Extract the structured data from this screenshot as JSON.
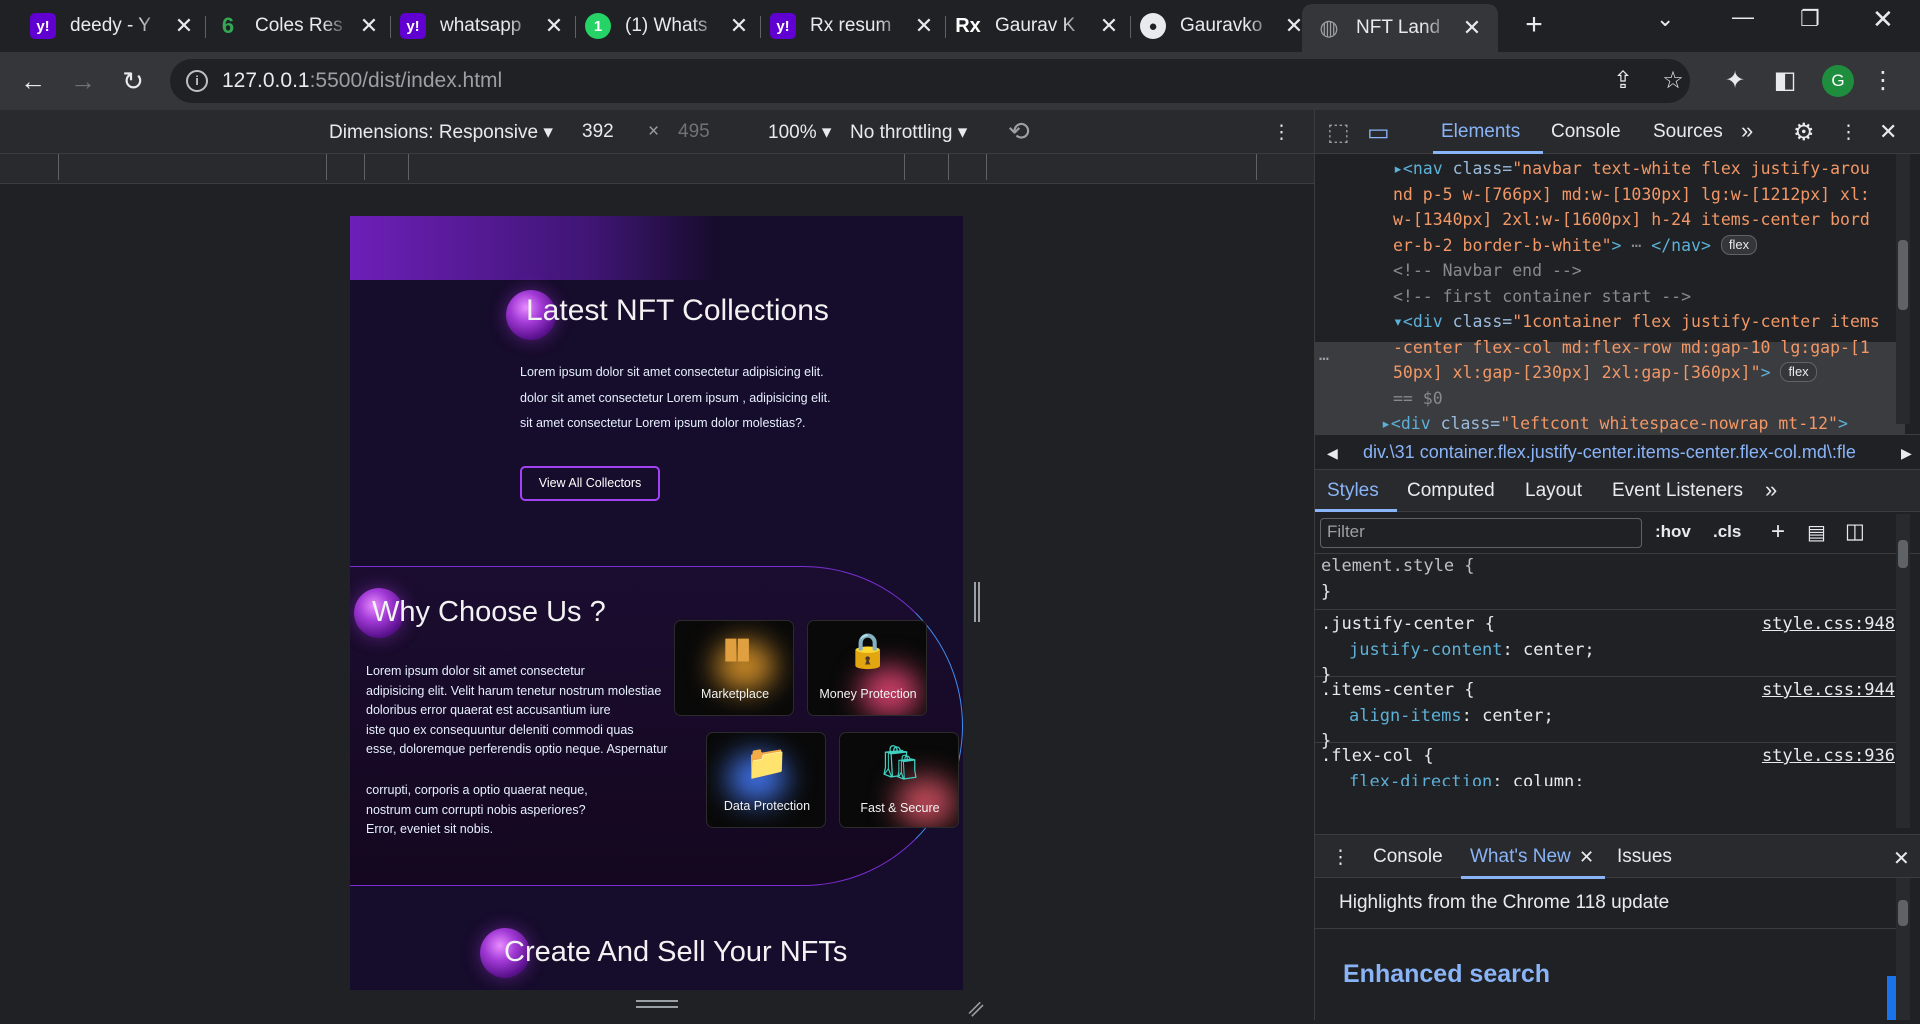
{
  "browser": {
    "tabs": [
      {
        "title": "deedy - Y",
        "favicon": "yahoo-icon",
        "favicon_text": "y!",
        "color": "#6001d2"
      },
      {
        "title": "Coles Res",
        "favicon": "coles-icon",
        "favicon_text": "6",
        "color": "#202124"
      },
      {
        "title": "whatsapp",
        "favicon": "yahoo-icon",
        "favicon_text": "y!",
        "color": "#6001d2"
      },
      {
        "title": "(1) Whats",
        "favicon": "whatsapp-icon",
        "favicon_text": "1",
        "color": "#25d366"
      },
      {
        "title": "Rx resum",
        "favicon": "yahoo-icon",
        "favicon_text": "y!",
        "color": "#6001d2"
      },
      {
        "title": "Gaurav K",
        "favicon": "rx-icon",
        "favicon_text": "Rx",
        "color": "#202124"
      },
      {
        "title": "Gauravko",
        "favicon": "github-icon",
        "favicon_text": "●",
        "color": "#202124"
      },
      {
        "title": "NFT Land",
        "favicon": "globe-icon",
        "favicon_text": "◍",
        "color": "#35363a"
      }
    ],
    "url_host": "127.0.0.1",
    "url_rest": ":5500/dist/index.html",
    "avatar_letter": "G"
  },
  "device_toolbar": {
    "dimensions_label": "Dimensions: Responsive",
    "width": "392",
    "times": "×",
    "height": "495",
    "zoom": "100%",
    "throttling": "No throttling"
  },
  "site": {
    "section1": {
      "title": "Latest NFT Collections",
      "lines": [
        "Lorem ipsum dolor sit amet consectetur adipisicing elit.",
        "dolor sit amet consectetur Lorem ipsum , adipisicing elit.",
        "sit amet consectetur Lorem ipsum dolor molestias?."
      ],
      "button": "View All Collectors"
    },
    "section2": {
      "title": "Why Choose Us ?",
      "lines_a": [
        "Lorem ipsum dolor sit amet consectetur",
        "adipisicing elit. Velit harum tenetur nostrum molestiae",
        "doloribus error quaerat est accusantium iure",
        "iste quo ex consequuntur deleniti commodi quas",
        "esse, doloremque perferendis optio neque. Aspernatur"
      ],
      "lines_b": [
        "corrupti, corporis a optio quaerat neque,",
        "nostrum cum corrupti nobis asperiores?",
        "Error, eveniet sit nobis."
      ],
      "cards": [
        {
          "label": "Marketplace",
          "icon": "marketplace-icon",
          "glyph": "▮▮",
          "glyph_color": "#e0a040",
          "glow": "#c98a28"
        },
        {
          "label": "Money Protection",
          "icon": "money-protection-icon",
          "glyph": "🔒",
          "glyph_color": "#20c0a0",
          "glow": "#d0406a"
        },
        {
          "label": "Data Protection",
          "icon": "data-protection-icon",
          "glyph": "📁",
          "glyph_color": "#3aa8ff",
          "glow": "#3f6fe0"
        },
        {
          "label": "Fast & Secure",
          "icon": "fast-secure-icon",
          "glyph": "🛍",
          "glyph_color": "#40d0c0",
          "glow": "#c04a5a"
        }
      ]
    },
    "section3": {
      "title": "Create And Sell Your NFTs"
    }
  },
  "devtools": {
    "tabs": [
      "Elements",
      "Console",
      "Sources"
    ],
    "dom_lines": [
      {
        "type": "code",
        "parts": [
          [
            "tag",
            "▸<nav "
          ],
          [
            "attr",
            "class="
          ],
          [
            "val",
            "\"navbar text-white flex justify-arou"
          ]
        ]
      },
      {
        "type": "code",
        "parts": [
          [
            "val",
            "nd p-5 w-[766px] md:w-[1030px] lg:w-[1212px] xl:"
          ]
        ]
      },
      {
        "type": "code",
        "parts": [
          [
            "val",
            "w-[1340px] 2xl:w-[1600px] h-24 items-center bord"
          ]
        ]
      },
      {
        "type": "code",
        "parts": [
          [
            "val",
            "er-b-2 border-b-white\""
          ],
          [
            "tag",
            ">"
          ],
          [
            "cmt",
            " ⋯ "
          ],
          [
            "tag",
            "</nav>"
          ]
        ],
        "pill": "flex"
      },
      {
        "type": "code",
        "parts": [
          [
            "cmt",
            "<!-- Navbar end -->"
          ]
        ]
      },
      {
        "type": "code",
        "parts": [
          [
            "cmt",
            "<!-- first container start -->"
          ]
        ]
      },
      {
        "type": "code",
        "parts": [
          [
            "tag",
            "▾<div "
          ],
          [
            "attr",
            "class="
          ],
          [
            "val",
            "\"1container flex justify-center items"
          ]
        ]
      },
      {
        "type": "code",
        "parts": [
          [
            "val",
            "-center flex-col md:flex-row md:gap-10 lg:gap-[1"
          ]
        ]
      },
      {
        "type": "code",
        "parts": [
          [
            "val",
            "50px] xl:gap-[230px] 2xl:gap-[360px]\""
          ],
          [
            "tag",
            ">"
          ]
        ],
        "pill": "flex"
      },
      {
        "type": "code",
        "parts": [
          [
            "cmt",
            "  == $0"
          ]
        ]
      },
      {
        "type": "code",
        "parts": [
          [
            "tag",
            "  ▸<div "
          ],
          [
            "attr",
            "class="
          ],
          [
            "val",
            "\"leftcont whitespace-nowrap mt-12\""
          ],
          [
            "tag",
            ">"
          ]
        ]
      }
    ],
    "breadcrumb": "div.\\31 container.flex.justify-center.items-center.flex-col.md\\:fle",
    "styles_tabs": [
      "Styles",
      "Computed",
      "Layout",
      "Event Listeners"
    ],
    "filter_placeholder": "Filter",
    "hov": ":hov",
    "cls": ".cls",
    "rules": [
      {
        "selector": "element.style {",
        "prop": "",
        "value": "",
        "source": ""
      },
      {
        "selector": ".justify-center {",
        "prop": "justify-content",
        "value": "center;",
        "source": "style.css:948"
      },
      {
        "selector": ".items-center {",
        "prop": "align-items",
        "value": "center;",
        "source": "style.css:944"
      },
      {
        "selector": ".flex-col {",
        "prop": "flex-direction",
        "value": "column;",
        "source": "style.css:936"
      }
    ],
    "drawer_tabs": [
      "Console",
      "What's New",
      "Issues"
    ],
    "whats_new_heading": "Highlights from the Chrome 118 update",
    "whats_new_link": "Enhanced search"
  }
}
